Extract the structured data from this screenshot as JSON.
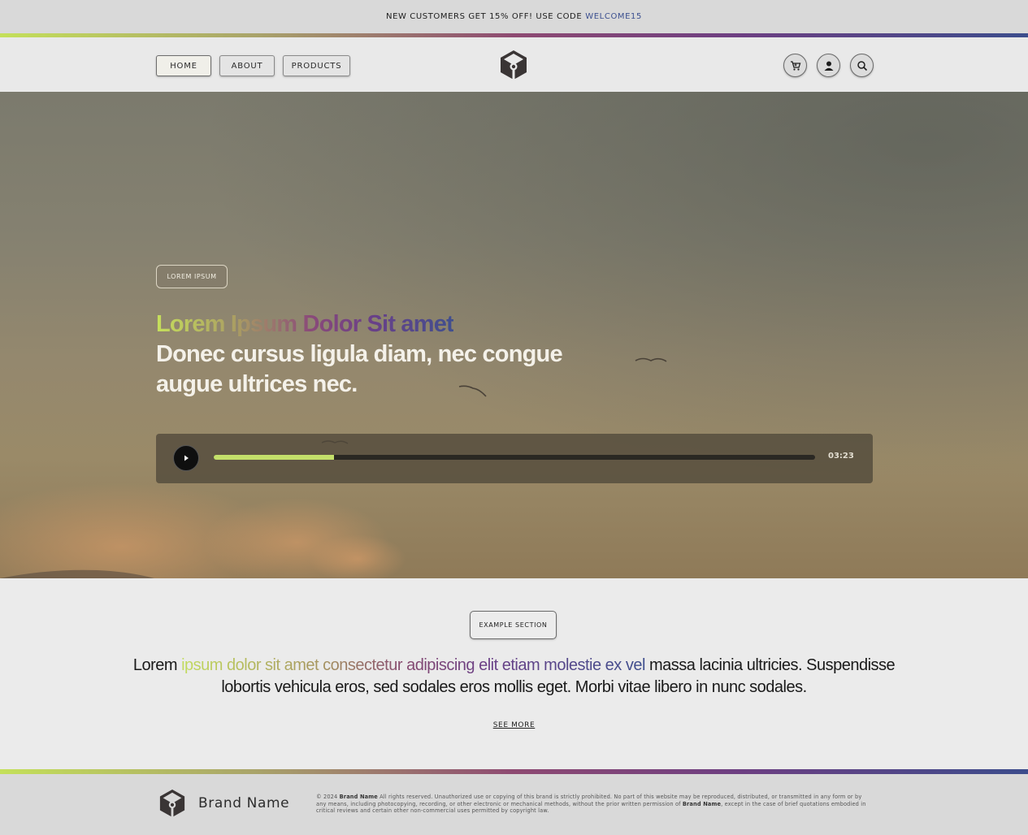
{
  "promo": {
    "text": "NEW CUSTOMERS GET 15% OFF! USE CODE",
    "code": "WELCOME15"
  },
  "nav": {
    "items": [
      {
        "label": "HOME",
        "active": true
      },
      {
        "label": "ABOUT",
        "active": false
      },
      {
        "label": "PRODUCTS",
        "active": false
      }
    ],
    "icons": [
      "cart-icon",
      "user-icon",
      "search-icon"
    ]
  },
  "hero": {
    "tag": "LOREM IPSUM",
    "title_gradient": "Lorem Ipsum Dolor Sit amet",
    "title_line2": "Donec cursus ligula diam, nec congue",
    "title_line3": "augue ultrices nec.",
    "player": {
      "time": "03:23",
      "progress": 0.2
    }
  },
  "example": {
    "tag": "EXAMPLE SECTION",
    "text_start": "Lorem ",
    "text_gradient": "ipsum dolor sit amet  consectetur adipiscing elit etiam molestie ex vel",
    "text_end": " massa lacinia ultricies. Suspendisse lobortis vehicula eros, sed sodales eros mollis eget. Morbi vitae libero in nunc sodales.",
    "see_more": "SEE MORE"
  },
  "footer": {
    "brand": "Brand Name",
    "legal_prefix": "© 2024",
    "legal_brand": "Brand Name",
    "legal_middle": "All rights reserved. Unauthorized use or copying of this brand is strictly prohibited. No part of this website may be reproduced, distributed, or transmitted in any form or by any means, including photocopying, recording, or other electronic or mechanical methods, without the prior written permission of",
    "legal_brand2": "Brand Name",
    "legal_end": ", except in the case of brief quotations embodied in critical reviews and certain other non-commercial uses permitted by copyright law."
  },
  "colors": {
    "accent_green": "#c4e06a",
    "accent_purple": "#8e4a72",
    "accent_blue": "#3c4d8c"
  }
}
